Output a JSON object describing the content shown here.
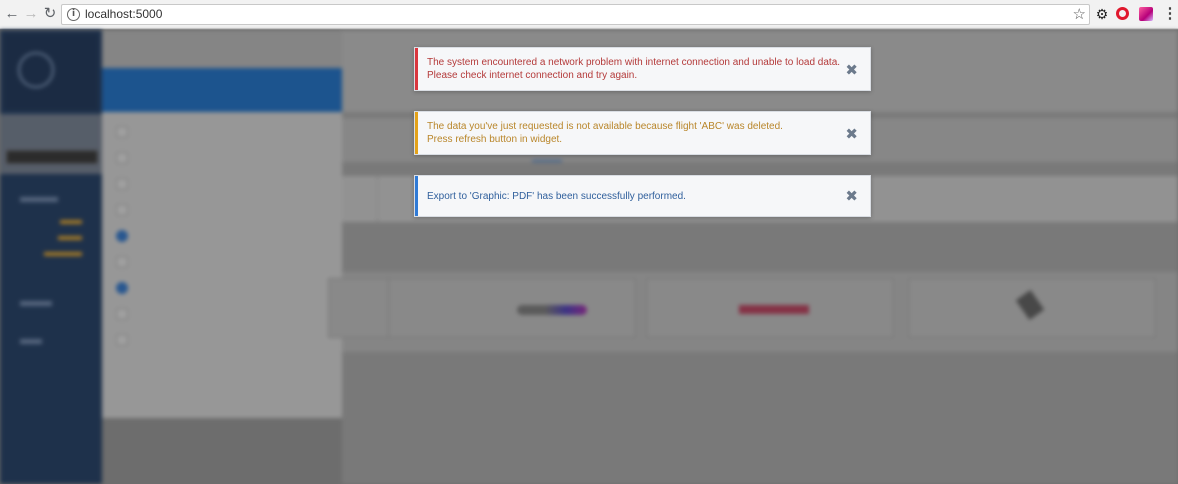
{
  "browser": {
    "url": "localhost:5000",
    "icons": {
      "back": "arrow-left-icon",
      "forward": "arrow-right-icon",
      "reload": "reload-icon",
      "info": "info-icon",
      "bookmark": "star-icon",
      "extension_1": "gear-icon",
      "extension_2": "opera-icon",
      "extension_3": "extension-icon",
      "menu": "more-vert-icon"
    }
  },
  "notifications": [
    {
      "type": "error",
      "accent": "#d9363e",
      "lines": [
        "The system encountered a network problem with internet connection and unable to load data.",
        "Please check internet connection and try again."
      ],
      "close_icon": "close-icon"
    },
    {
      "type": "warning",
      "accent": "#e3a21a",
      "lines": [
        "The data you've just requested is not available because flight 'ABC' was deleted.",
        "Press refresh button in widget."
      ],
      "close_icon": "close-icon"
    },
    {
      "type": "success",
      "accent": "#2f7ad6",
      "lines": [
        "Export to 'Graphic: PDF' has been successfully performed."
      ],
      "close_icon": "close-icon"
    }
  ],
  "colors": {
    "nav_background": "#102a4e",
    "apply_button": "#0d5aab",
    "overlay": "#7d7d7d"
  }
}
